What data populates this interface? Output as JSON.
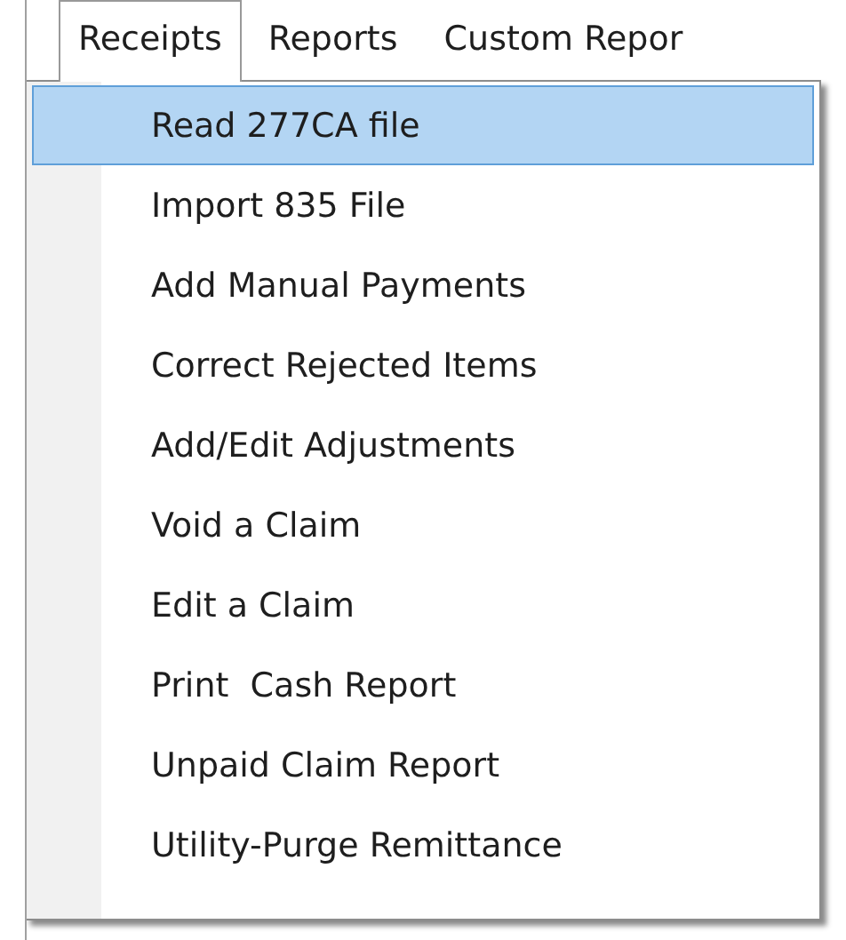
{
  "menu_bar": [
    {
      "label": "Receipts",
      "selected": true
    },
    {
      "label": "Reports",
      "selected": false
    },
    {
      "label": "Custom Repor",
      "selected": false
    }
  ],
  "dropdown": [
    {
      "label": "Read 277CA file",
      "selected": true
    },
    {
      "label": "Import 835 File",
      "selected": false
    },
    {
      "label": "Add Manual Payments",
      "selected": false
    },
    {
      "label": "Correct Rejected Items",
      "selected": false
    },
    {
      "label": "Add/Edit Adjustments",
      "selected": false
    },
    {
      "label": "Void a Claim",
      "selected": false
    },
    {
      "label": "Edit a Claim",
      "selected": false
    },
    {
      "label": "Print  Cash Report",
      "selected": false
    },
    {
      "label": "Unpaid Claim Report",
      "selected": false
    },
    {
      "label": "Utility-Purge Remittance",
      "selected": false
    }
  ]
}
